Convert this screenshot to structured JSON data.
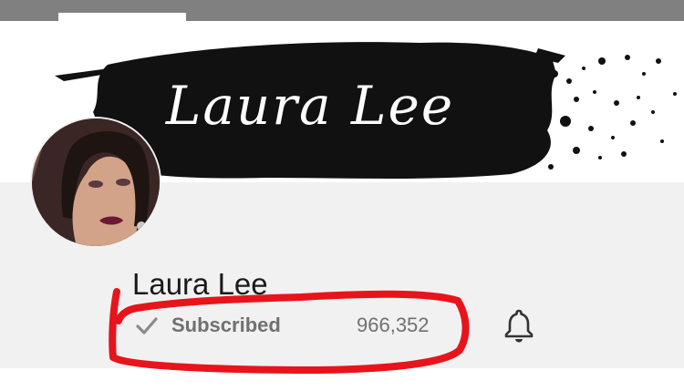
{
  "banner": {
    "title": "Laura Lee"
  },
  "channel": {
    "name": "Laura Lee",
    "subscribe_state": "Subscribed",
    "subscriber_count": "966,352"
  },
  "icons": {
    "check": "checkmark-icon",
    "bell": "notification-bell-icon"
  },
  "colors": {
    "annotation": "#e8141b",
    "banner_brush": "#111111",
    "text_muted": "#707070"
  }
}
